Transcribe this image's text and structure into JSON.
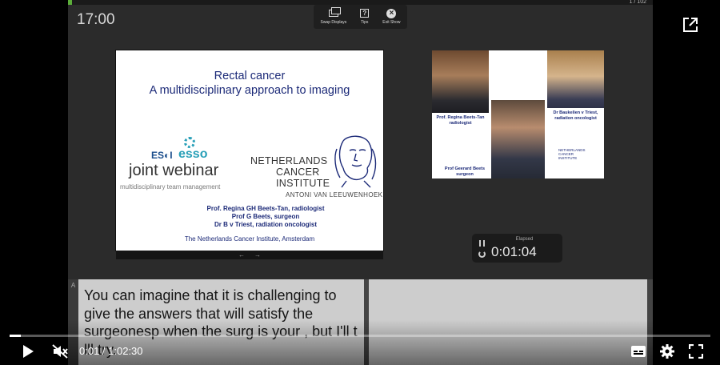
{
  "presenter": {
    "slide_counter": "1 / 102",
    "clock": "17:00",
    "toolbar": [
      {
        "label": "Swap Displays",
        "icon": "swap-displays-icon"
      },
      {
        "label": "Tips",
        "icon": "help-icon"
      },
      {
        "label": "Exit Show",
        "icon": "close-icon"
      }
    ],
    "elapsed_label": "Elapsed",
    "elapsed_value": "0:01:04",
    "notes_gutter": "A"
  },
  "slide": {
    "title_line1": "Rectal cancer",
    "title_line2": "A multidisciplinary approach to imaging",
    "esol": "ES◐I",
    "esso": "esso",
    "webinar_title": "joint webinar",
    "webinar_sub": "multidisciplinary team management",
    "institute_line1": "NETHERLANDS",
    "institute_line2": "CANCER",
    "institute_line3": "INSTITUTE",
    "institute_sub": "ANTONI VAN LEEUWENHOEK",
    "speaker1": "Prof. Regina GH Beets-Tan, radiologist",
    "speaker2": "Prof G Beets, surgeon",
    "speaker3": "Dr B v Triest, radiation oncologist",
    "footer": "The Netherlands Cancer Institute, Amsterdam",
    "nav_prev": "←",
    "nav_next": "→"
  },
  "next_slide": {
    "caption1_line1": "Prof. Regina Beets-Tan",
    "caption1_line2": "radiologist",
    "caption2_line1": "Prof Geerard Beets",
    "caption2_line2": "surgeon",
    "caption3_line1": "Dr Baukelien v Triest,",
    "caption3_line2": "radiation oncologist",
    "logo_line1": "NETHERLANDS",
    "logo_line2": "CANCER",
    "logo_line3": "INSTITUTE"
  },
  "notes": {
    "text": "You can imagine that it is challenging to give the answers that will satisfy the surgeonesp when the surg is your , but I'll t lll try."
  },
  "player": {
    "time_readout": "0:01 / 1:02:30",
    "progress_fraction": 0.0003,
    "colors": {
      "accent": "#ffffff",
      "presenter_bar": "#5cae3a"
    }
  }
}
